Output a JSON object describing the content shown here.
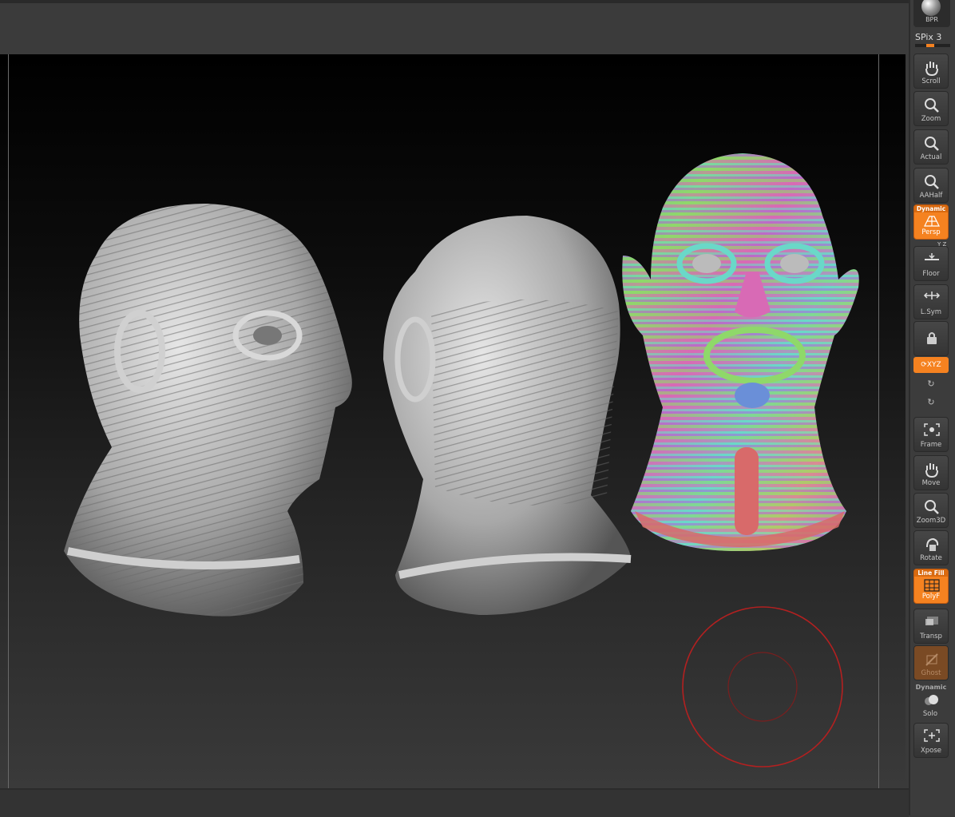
{
  "shelf": {
    "bpr_label": "BPR",
    "spix_label": "SPix 3",
    "persp_axes": "Y Z",
    "xyz_label": "XYZ",
    "tools": [
      {
        "key": "scroll",
        "label": "Scroll"
      },
      {
        "key": "zoom",
        "label": "Zoom"
      },
      {
        "key": "actual",
        "label": "Actual"
      },
      {
        "key": "aahalf",
        "label": "AAHalf"
      },
      {
        "key": "persp",
        "label": "Persp",
        "sup": "Dynamic"
      },
      {
        "key": "floor",
        "label": "Floor"
      },
      {
        "key": "lsym",
        "label": "L.Sym"
      },
      {
        "key": "frame",
        "label": "Frame"
      },
      {
        "key": "move",
        "label": "Move"
      },
      {
        "key": "zoom3d",
        "label": "Zoom3D"
      },
      {
        "key": "rotate",
        "label": "Rotate"
      },
      {
        "key": "polyf",
        "label": "PolyF",
        "sup": "Line Fill"
      },
      {
        "key": "transp",
        "label": "Transp"
      },
      {
        "key": "ghost",
        "label": "Ghost"
      },
      {
        "key": "solo",
        "label": "Solo",
        "sup": "Dynamic"
      },
      {
        "key": "xpose",
        "label": "Xpose"
      }
    ]
  },
  "colors": {
    "accent": "#f58220",
    "brush_cursor": "#b32020",
    "polygroup_palette": [
      "#6a8fd8",
      "#8fd86a",
      "#d86ab5",
      "#6ad8c8",
      "#d8b56a",
      "#a86ad8",
      "#d86a6a"
    ]
  },
  "icons": [
    "hand-icon",
    "magnifier-icon",
    "perspective-grid-icon",
    "floor-icon",
    "symmetry-arrows-icon",
    "lock-icon",
    "rotate-axis-icon",
    "frame-icon",
    "rotate-icon",
    "polyframe-icon",
    "transparency-icon",
    "ghost-icon",
    "solo-icon",
    "xpose-icon"
  ]
}
